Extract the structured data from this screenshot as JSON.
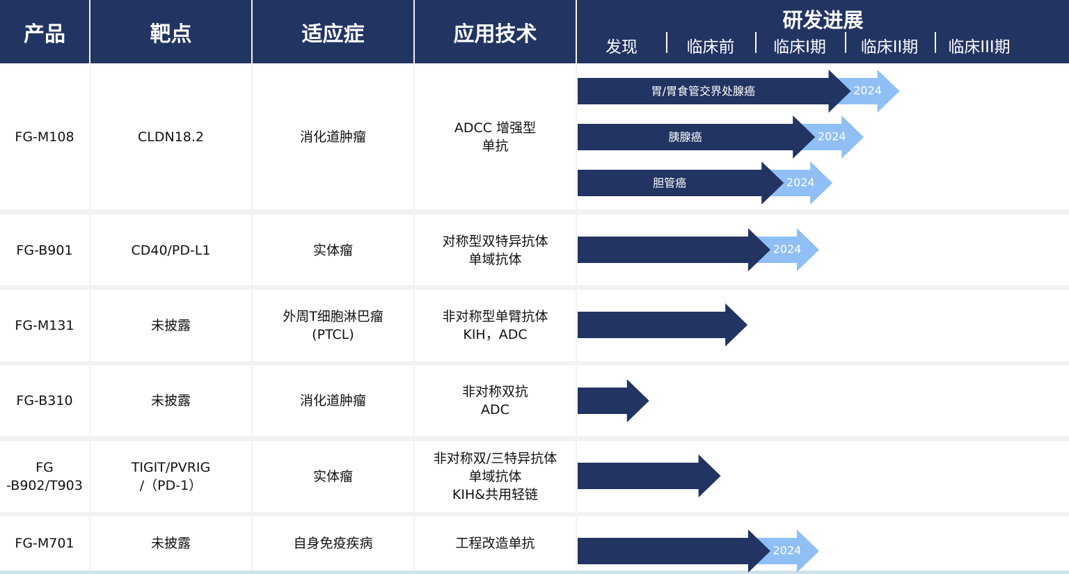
{
  "headers": {
    "product": "产品",
    "target": "靶点",
    "indication": "适应症",
    "technology": "应用技术",
    "progress": "研发进展"
  },
  "stages": [
    "发现",
    "临床前",
    "临床I期",
    "临床II期",
    "临床III期"
  ],
  "colors": {
    "header_bg": "#223462",
    "bar": "#223462",
    "highlight": "#8fbff5",
    "row_bg": "#ffffff",
    "separator": "#f2f2f2"
  },
  "rows": [
    {
      "product": "FG-M108",
      "target": "CLDN18.2",
      "indication": "消化道肿瘤",
      "technology": "ADCC 增强型\n单抗",
      "bars": [
        {
          "label": "胃/胃食管交界处腺癌",
          "stage_reached": 3.6,
          "highlight_year": "2024"
        },
        {
          "label": "胰腺癌",
          "stage_reached": 3.2,
          "highlight_year": "2024"
        },
        {
          "label": "胆管癌",
          "stage_reached": 2.85,
          "highlight_year": "2024"
        }
      ]
    },
    {
      "product": "FG-B901",
      "target": "CD40/PD-L1",
      "indication": "实体瘤",
      "technology": "对称型双特异抗体\n单域抗体",
      "bars": [
        {
          "label": "",
          "stage_reached": 2.7,
          "highlight_year": "2024"
        }
      ]
    },
    {
      "product": "FG-M131",
      "target": "未披露",
      "indication": "外周T细胞淋巴瘤\n(PTCL)",
      "technology": "非对称型单臂抗体\nKIH，ADC",
      "bars": [
        {
          "label": "",
          "stage_reached": 1.9,
          "highlight_year": ""
        }
      ]
    },
    {
      "product": "FG-B310",
      "target": "未披露",
      "indication": "消化道肿瘤",
      "technology": "非对称双抗\nADC",
      "bars": [
        {
          "label": "",
          "stage_reached": 0.8,
          "highlight_year": ""
        }
      ]
    },
    {
      "product": "FG\n-B902/T903",
      "target": "TIGIT/PVRIG\n/（PD-1）",
      "indication": "实体瘤",
      "technology": "非对称双/三特异抗体\n单域抗体\nKIH&共用轻链",
      "bars": [
        {
          "label": "",
          "stage_reached": 1.6,
          "highlight_year": ""
        }
      ]
    },
    {
      "product": "FG-M701",
      "target": "未披露",
      "indication": "自身免疫疾病",
      "technology": "工程改造单抗",
      "bars": [
        {
          "label": "",
          "stage_reached": 2.7,
          "highlight_year": "2024"
        }
      ]
    }
  ]
}
